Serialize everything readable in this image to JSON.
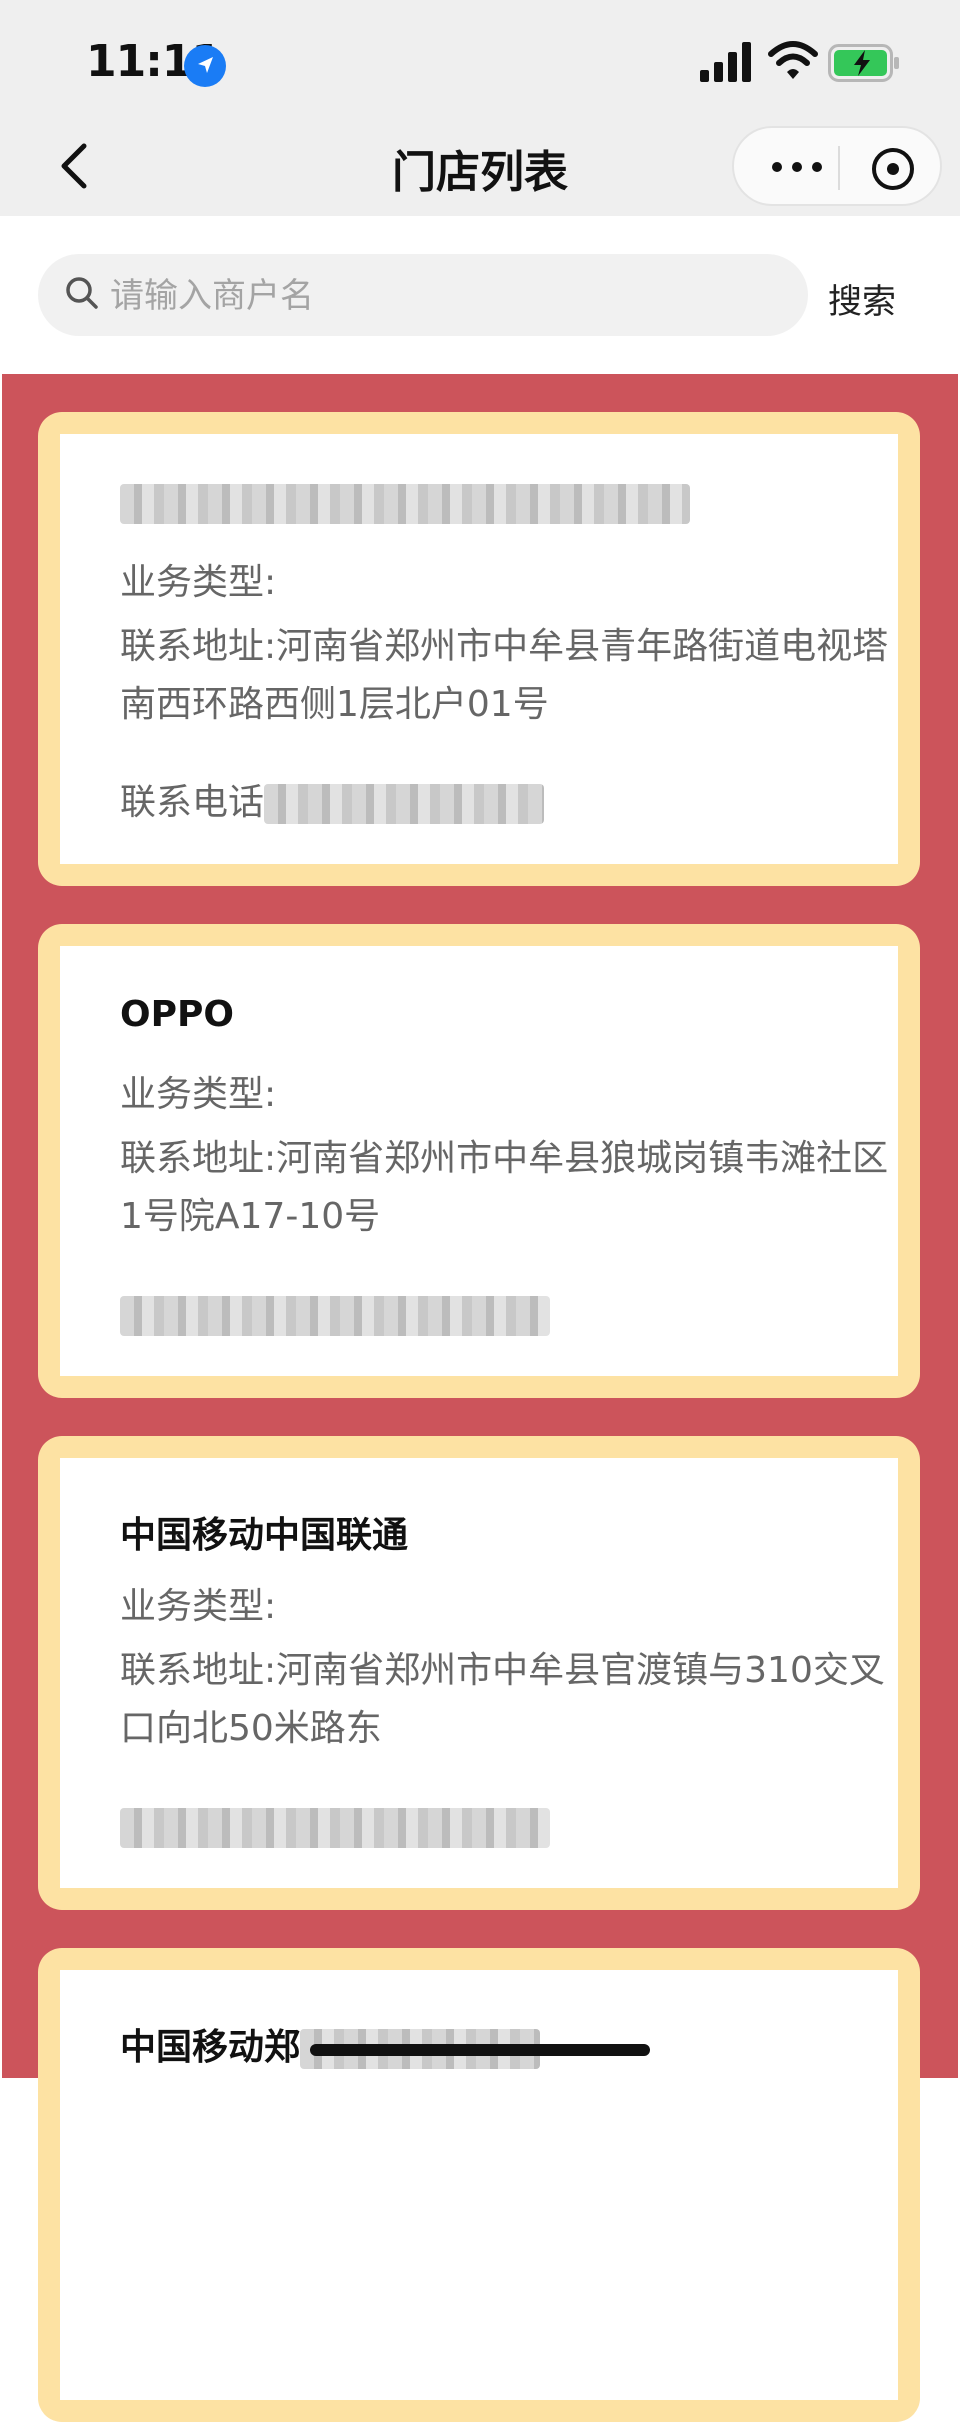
{
  "status_bar": {
    "time": "11:11"
  },
  "nav": {
    "title": "门店列表"
  },
  "search": {
    "placeholder": "请输入商户名",
    "button": "搜索"
  },
  "stores": [
    {
      "name": "",
      "type_label": "业务类型:",
      "address": "联系地址:河南省郑州市中牟县青年路街道电视塔南西环路西侧1层北户01号",
      "phone_label": "联系电话"
    },
    {
      "name": "OPPO",
      "type_label": "业务类型:",
      "address": "联系地址:河南省郑州市中牟县狼城岗镇韦滩社区1号院A17-10号",
      "phone_label": ""
    },
    {
      "name": "中国移动中国联通",
      "type_label": "业务类型:",
      "address": "联系地址:河南省郑州市中牟县官渡镇与310交叉口向北50米路东",
      "phone_label": ""
    },
    {
      "name": "中国移动郑",
      "type_label": "",
      "address": "",
      "phone_label": ""
    }
  ],
  "colors": {
    "list_bg": "#cc545b",
    "card_border": "#fde2a3",
    "accent": "#1a7cf5"
  }
}
